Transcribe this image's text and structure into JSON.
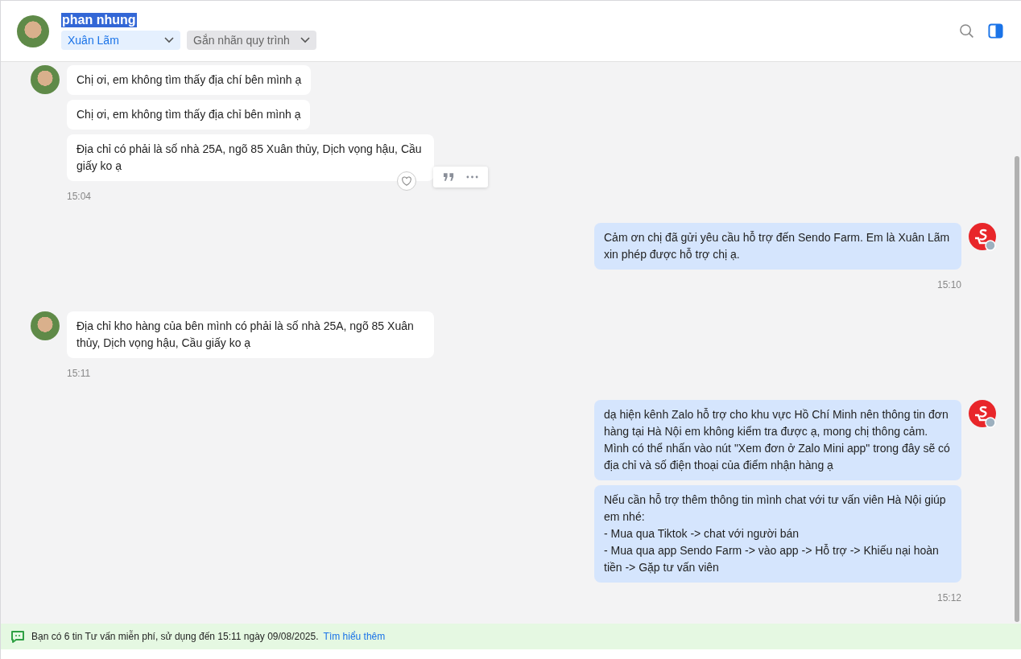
{
  "header": {
    "name": "phan nhung",
    "name_selected": true,
    "assignee": "Xuân Lãm",
    "label_placeholder": "Gắn nhãn quy trình"
  },
  "messages": [
    {
      "kind": "in",
      "time": "15:04",
      "bubbles": [
        {
          "text": "Chị ơi, em không tìm thấy địa chí bên mình ạ",
          "show_actions": false
        },
        {
          "text": "Chị ơi, em không tìm thấy địa chỉ bên mình ạ",
          "show_actions": false
        },
        {
          "text": "Địa chỉ có phải là số nhà 25A, ngõ 85 Xuân thủy, Dịch vọng hậu, Cầu giấy ko ạ",
          "show_actions": true
        }
      ]
    },
    {
      "kind": "out",
      "time": "15:10",
      "bubbles": [
        {
          "text": "Cảm ơn chị đã gửi yêu cầu hỗ trợ đến Sendo Farm. Em là Xuân Lãm xin phép được hỗ trợ chị ạ.",
          "show_actions": false
        }
      ]
    },
    {
      "kind": "in",
      "time": "15:11",
      "bubbles": [
        {
          "text": "Địa chỉ kho hàng của bên mình có phải là số nhà 25A, ngõ 85 Xuân thủy, Dịch vọng hậu, Cầu giấy ko ạ",
          "show_actions": false
        }
      ]
    },
    {
      "kind": "out",
      "time": "15:12",
      "bubbles": [
        {
          "text": "dạ hiện kênh Zalo hỗ trợ cho khu vực Hồ Chí Minh nên thông tin đơn hàng tại Hà Nội em không kiểm tra được ạ, mong chị thông cảm. Mình có thể nhấn vào nút \"Xem đơn ở Zalo Mini app\" trong đây sẽ có địa chỉ và số điện thoại của điểm nhận hàng ạ",
          "show_actions": false
        },
        {
          "text": "Nếu cần hỗ trợ thêm thông tin mình chat với tư vấn viên Hà Nội giúp em nhé:\n- Mua qua Tiktok -> chat với người bán\n- Mua qua app Sendo Farm -> vào app -> Hỗ trợ -> Khiếu nại hoàn tiền -> Gặp tư vấn viên",
          "show_actions": false
        }
      ]
    }
  ],
  "notice": {
    "text": "Bạn có 6 tin Tư vấn miễn phí, sử dụng đến 15:11 ngày 09/08/2025.",
    "link": "Tìm hiểu thêm"
  }
}
